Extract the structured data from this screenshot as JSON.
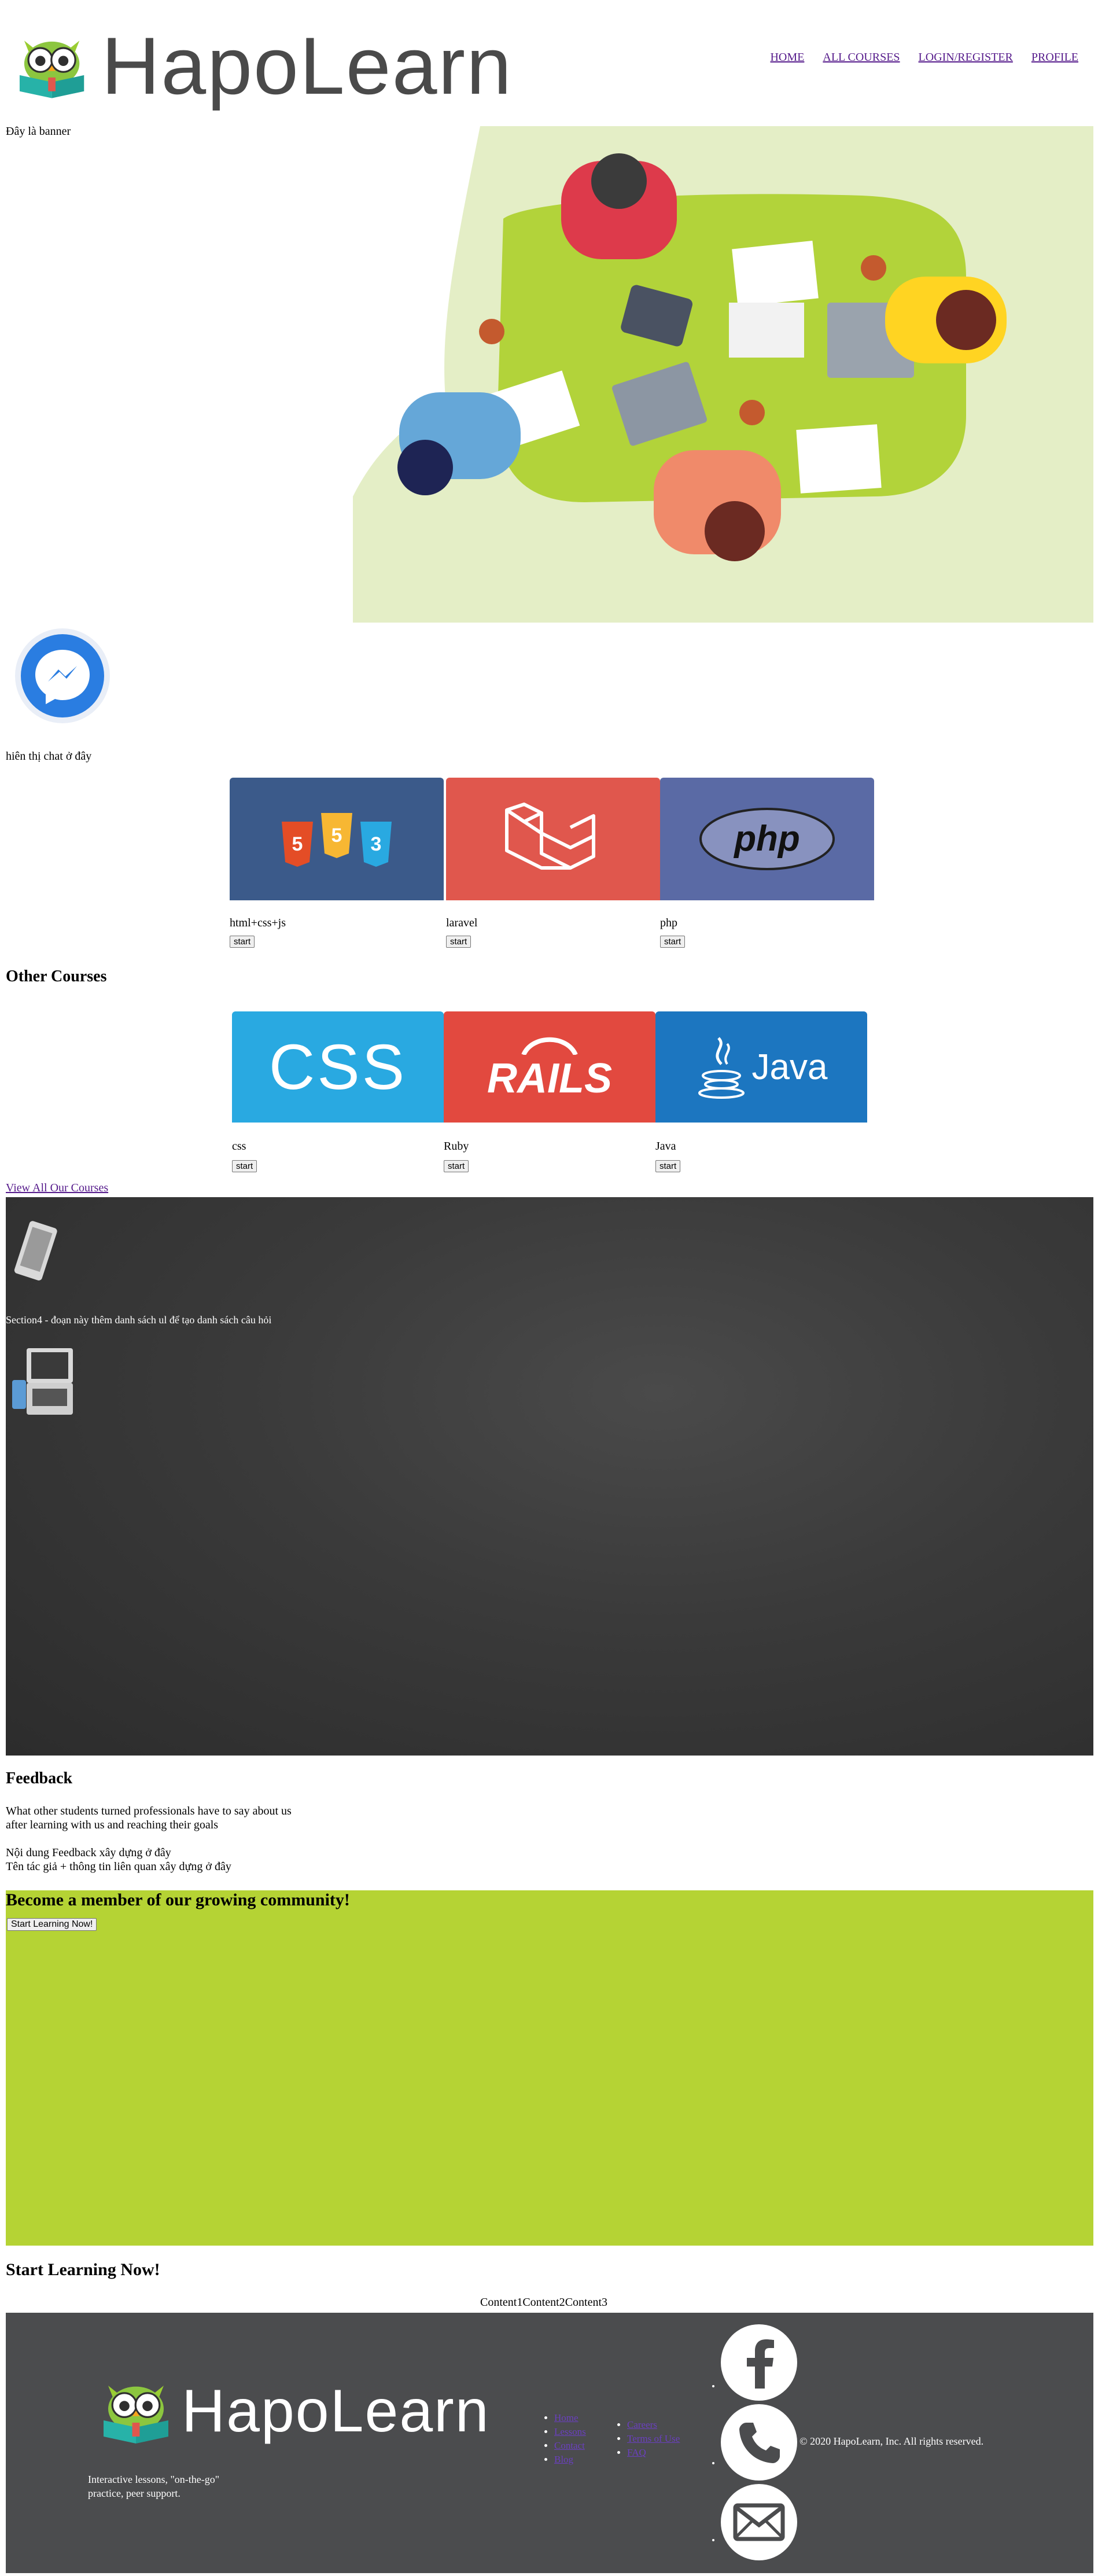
{
  "brand": {
    "name_part1": "Hap",
    "name_part2": "o",
    "name_part3": "Learn"
  },
  "nav": [
    "HOME",
    "ALL COURSES",
    "LOGIN/REGISTER",
    "PROFILE"
  ],
  "banner": {
    "label": "Đây là banner"
  },
  "chat": {
    "label": "hiên thị chat ở đây"
  },
  "courses": [
    {
      "title": "html+css+js",
      "button": "start",
      "thumb": "html-css-js-logos",
      "bg": "#3b5a8a"
    },
    {
      "title": "laravel",
      "button": "start",
      "thumb": "laravel-logo",
      "bg": "#e0574d"
    },
    {
      "title": "php",
      "button": "start",
      "thumb": "php-logo",
      "bg": "#5a6aa5"
    }
  ],
  "other_courses": {
    "heading": "Other Courses",
    "items": [
      {
        "title": "css",
        "button": "start",
        "logo_text": "CSS",
        "bg": "#29a9e1"
      },
      {
        "title": "Ruby",
        "button": "start",
        "logo_text": "RAILS",
        "bg": "#e2493f"
      },
      {
        "title": "Java",
        "button": "start",
        "logo_text": "Java",
        "bg": "#1c76c0"
      }
    ],
    "view_all": "View All Our Courses"
  },
  "section4": {
    "text": "Section4 - đoạn này thêm danh sách ul để tạo danh sách câu hỏi"
  },
  "feedback": {
    "heading": "Feedback",
    "desc_line1": "What other students turned professionals have to say about us",
    "desc_line2": "after learning with us and reaching their goals",
    "content_line1": "Nội dung Feedback xây dựng ở đây",
    "content_line2": "Tên tác giả + thông tin liên quan xây dựng ở đây"
  },
  "community": {
    "heading": "Become a member of our growing community!",
    "button": "Start Learning Now!",
    "bg": "#b5d334"
  },
  "start_learning": {
    "heading": "Start Learning Now!",
    "tabs": [
      "Content1",
      "Content2",
      "Content3"
    ]
  },
  "footer": {
    "tagline_line1": "Interactive lessons, \"on-the-go\"",
    "tagline_line2": "practice, peer support.",
    "links_col1": [
      "Home",
      "Lessons",
      "Contact",
      "Blog"
    ],
    "links_col2": [
      "Careers",
      "Terms of Use",
      "FAQ"
    ],
    "social_icons": [
      "facebook-icon",
      "phone-icon",
      "mail-icon"
    ],
    "copyright": "© 2020 HapoLearn, Inc. All rights reserved."
  },
  "colors": {
    "brand_green": "#b5d334",
    "footer_bg": "#4b4c4e",
    "link": "#551a8b"
  }
}
